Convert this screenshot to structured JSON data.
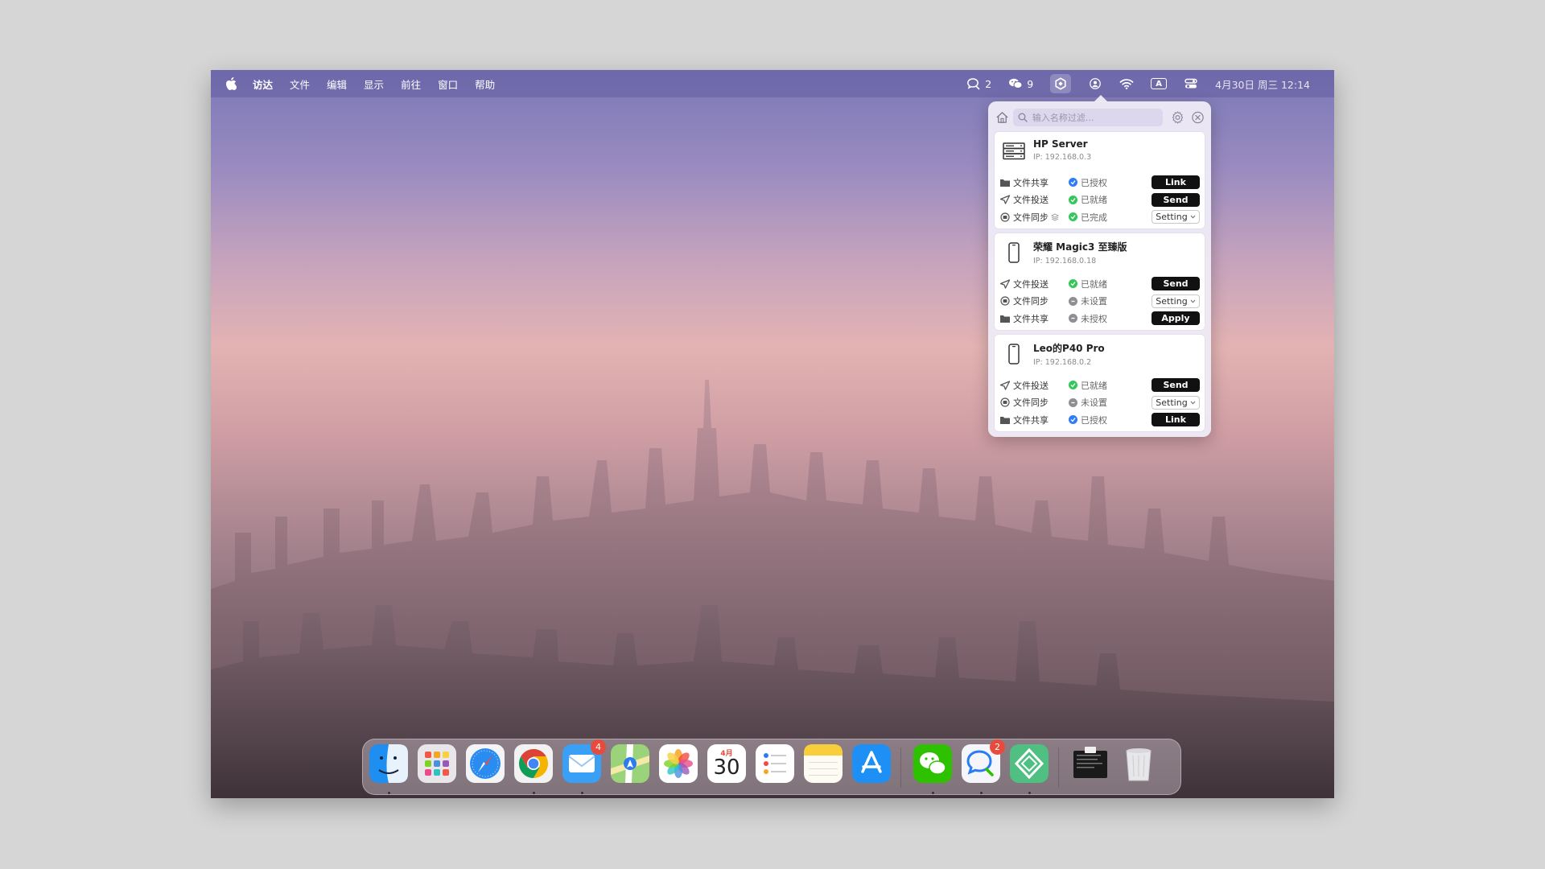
{
  "menubar": {
    "items": [
      "访达",
      "文件",
      "编辑",
      "显示",
      "前往",
      "窗口",
      "帮助"
    ],
    "chat_count": "2",
    "wechat_count": "9",
    "input_label": "A",
    "datetime": "4月30日 周三 12:14"
  },
  "popover": {
    "search_placeholder": "输入名称过滤...",
    "devices": [
      {
        "name": "HP Server",
        "ip": "IP: 192.168.0.3",
        "icon": "server-icon",
        "rows": [
          {
            "label": "文件共享",
            "status": "已授权",
            "button": "Link"
          },
          {
            "label": "文件投送",
            "status": "已就绪",
            "button": "Send"
          },
          {
            "label": "文件同步",
            "status": "已完成",
            "button": "Setting"
          }
        ]
      },
      {
        "name": "荣耀 Magic3 至臻版",
        "ip": "IP: 192.168.0.18",
        "icon": "phone-icon",
        "rows": [
          {
            "label": "文件投送",
            "status": "已就绪",
            "button": "Send"
          },
          {
            "label": "文件同步",
            "status": "未设置",
            "button": "Setting"
          },
          {
            "label": "文件共享",
            "status": "未授权",
            "button": "Apply"
          }
        ]
      },
      {
        "name": "Leo的P40 Pro",
        "ip": "IP: 192.168.0.2",
        "icon": "phone-icon",
        "rows": [
          {
            "label": "文件投送",
            "status": "已就绪",
            "button": "Send"
          },
          {
            "label": "文件同步",
            "status": "未设置",
            "button": "Setting"
          },
          {
            "label": "文件共享",
            "status": "已授权",
            "button": "Link"
          }
        ]
      }
    ]
  },
  "dock": {
    "mail_badge": "4",
    "calendar_month": "4月",
    "calendar_day": "30",
    "chat_badge": "2"
  },
  "colors": {
    "status_blue": "#2f7cf6",
    "status_green": "#34c759",
    "status_gray": "#8e8e93",
    "button_dark": "#111111"
  }
}
